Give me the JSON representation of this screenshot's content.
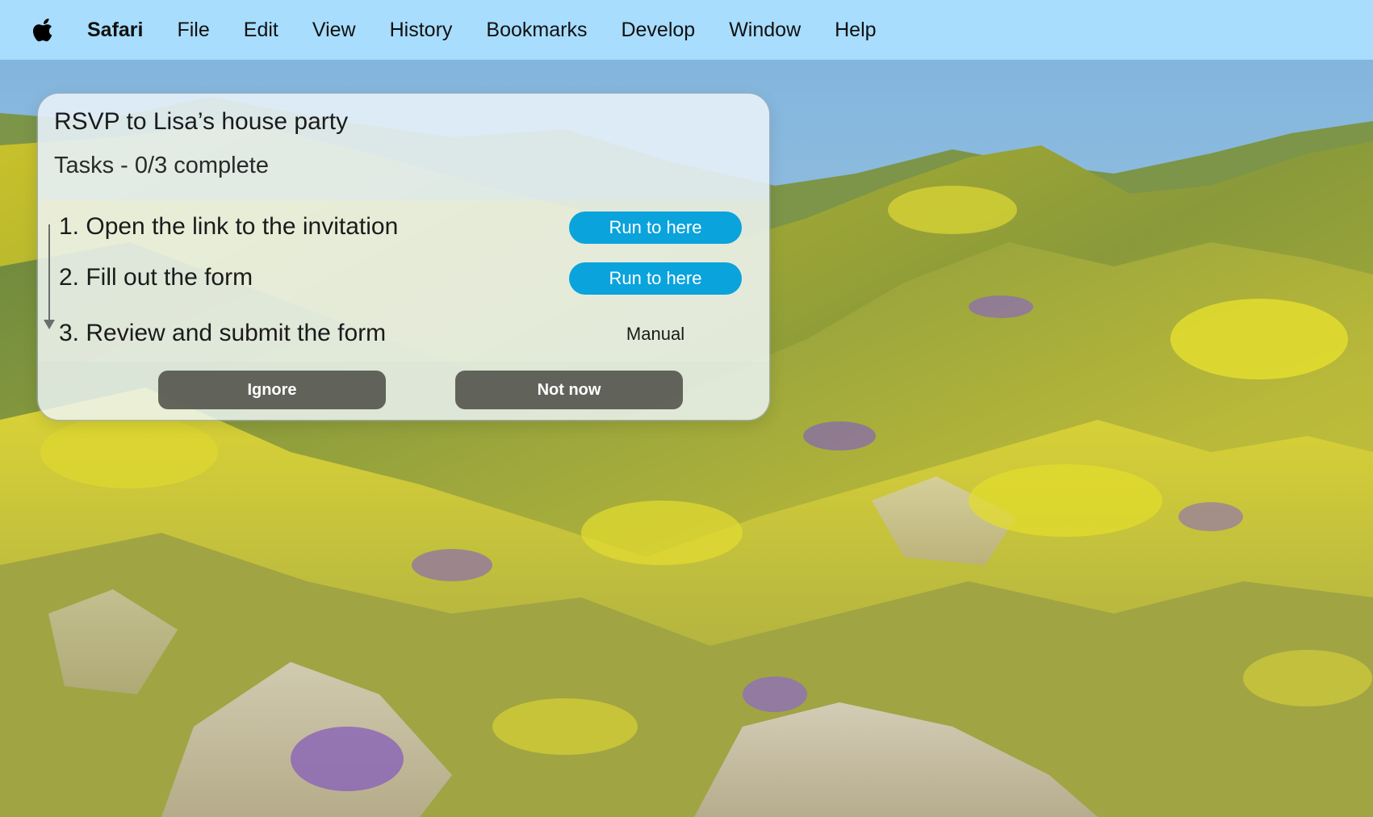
{
  "menubar": {
    "apple_icon": "apple-logo-icon",
    "app_name": "Safari",
    "items": [
      "File",
      "Edit",
      "View",
      "History",
      "Bookmarks",
      "Develop",
      "Window",
      "Help"
    ]
  },
  "task_panel": {
    "title": "RSVP to Lisa’s house party",
    "subtitle": "Tasks - 0/3 complete",
    "tasks": [
      {
        "label": "1. Open the link to the invitation",
        "action": "Run to here"
      },
      {
        "label": "2.  Fill out the form",
        "action": "Run to here"
      },
      {
        "label": "3.  Review and submit the form",
        "action": "Manual"
      }
    ],
    "ignore_label": "Ignore",
    "not_now_label": "Not now"
  },
  "colors": {
    "menubar_bg": "#a8ddfd",
    "run_button": "#0aa3dc",
    "footer_button": "#46463e"
  }
}
